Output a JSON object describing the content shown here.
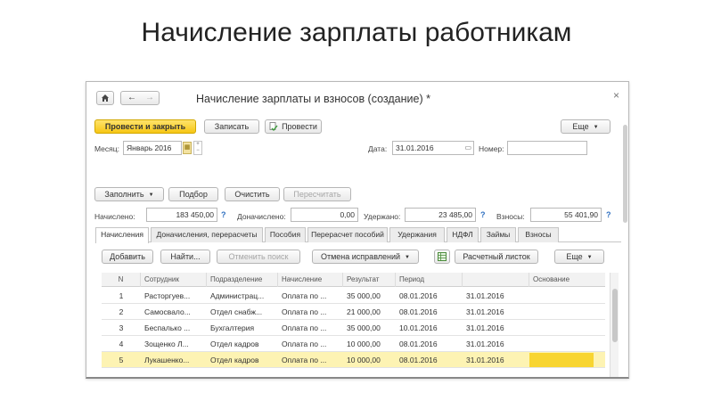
{
  "slide_title": "Начисление зарплаты работникам",
  "window": {
    "title": "Начисление зарплаты и взносов (создание) *",
    "nav": {
      "home_icon": "home-icon",
      "back_icon": "back-arrow-icon",
      "forward_icon": "forward-arrow-icon"
    },
    "close_symbol": "×"
  },
  "toolbar": {
    "post_close": "Провести и закрыть",
    "save": "Записать",
    "post": "Провести",
    "more": "Еще"
  },
  "header": {
    "month_label": "Месяц:",
    "month_value": "Январь 2016",
    "date_label": "Дата:",
    "date_value": "31.01.2016",
    "number_label": "Номер:",
    "number_value": ""
  },
  "actions": {
    "fill": "Заполнить",
    "select": "Подбор",
    "clear": "Очистить",
    "recalc": "Пересчитать"
  },
  "totals": {
    "accrued_label": "Начислено:",
    "accrued_value": "183 450,00",
    "additional_label": "Доначислено:",
    "additional_value": "0,00",
    "withheld_label": "Удержано:",
    "withheld_value": "23 485,00",
    "contrib_label": "Взносы:",
    "contrib_value": "55 401,90",
    "help": "?"
  },
  "tabs": [
    {
      "label": "Начисления"
    },
    {
      "label": "Доначисления, перерасчеты"
    },
    {
      "label": "Пособия"
    },
    {
      "label": "Перерасчет пособий"
    },
    {
      "label": "Удержания"
    },
    {
      "label": "НДФЛ"
    },
    {
      "label": "Займы"
    },
    {
      "label": "Взносы"
    }
  ],
  "table_toolbar": {
    "add": "Добавить",
    "find": "Найти...",
    "cancel_search": "Отменить поиск",
    "cancel_corrections": "Отмена исправлений",
    "payslip": "Расчетный листок",
    "more": "Еще"
  },
  "table": {
    "columns": [
      "N",
      "Сотрудник",
      "Подразделение",
      "Начисление",
      "Результат",
      "Период",
      "",
      "Основание"
    ],
    "rows": [
      {
        "n": "1",
        "employee": "Расторгуев...",
        "department": "Администрац...",
        "accrual": "Оплата по ...",
        "result": "35 000,00",
        "period_start": "08.01.2016",
        "period_end": "31.01.2016",
        "basis": ""
      },
      {
        "n": "2",
        "employee": "Самосвало...",
        "department": "Отдел снабж...",
        "accrual": "Оплата по ...",
        "result": "21 000,00",
        "period_start": "08.01.2016",
        "period_end": "31.01.2016",
        "basis": ""
      },
      {
        "n": "3",
        "employee": "Беспалько ...",
        "department": "Бухгалтерия",
        "accrual": "Оплата по ...",
        "result": "35 000,00",
        "period_start": "10.01.2016",
        "period_end": "31.01.2016",
        "basis": ""
      },
      {
        "n": "4",
        "employee": "Зощенко Л...",
        "department": "Отдел кадров",
        "accrual": "Оплата по ...",
        "result": "10 000,00",
        "period_start": "08.01.2016",
        "period_end": "31.01.2016",
        "basis": ""
      },
      {
        "n": "5",
        "employee": "Лукашенко...",
        "department": "Отдел кадров",
        "accrual": "Оплата по ...",
        "result": "10 000,00",
        "period_start": "08.01.2016",
        "period_end": "31.01.2016",
        "basis": ""
      }
    ]
  },
  "colors": {
    "accent_yellow": "#f6c615",
    "selected_row": "#fdf3b3",
    "link_blue": "#2f6fc0"
  }
}
